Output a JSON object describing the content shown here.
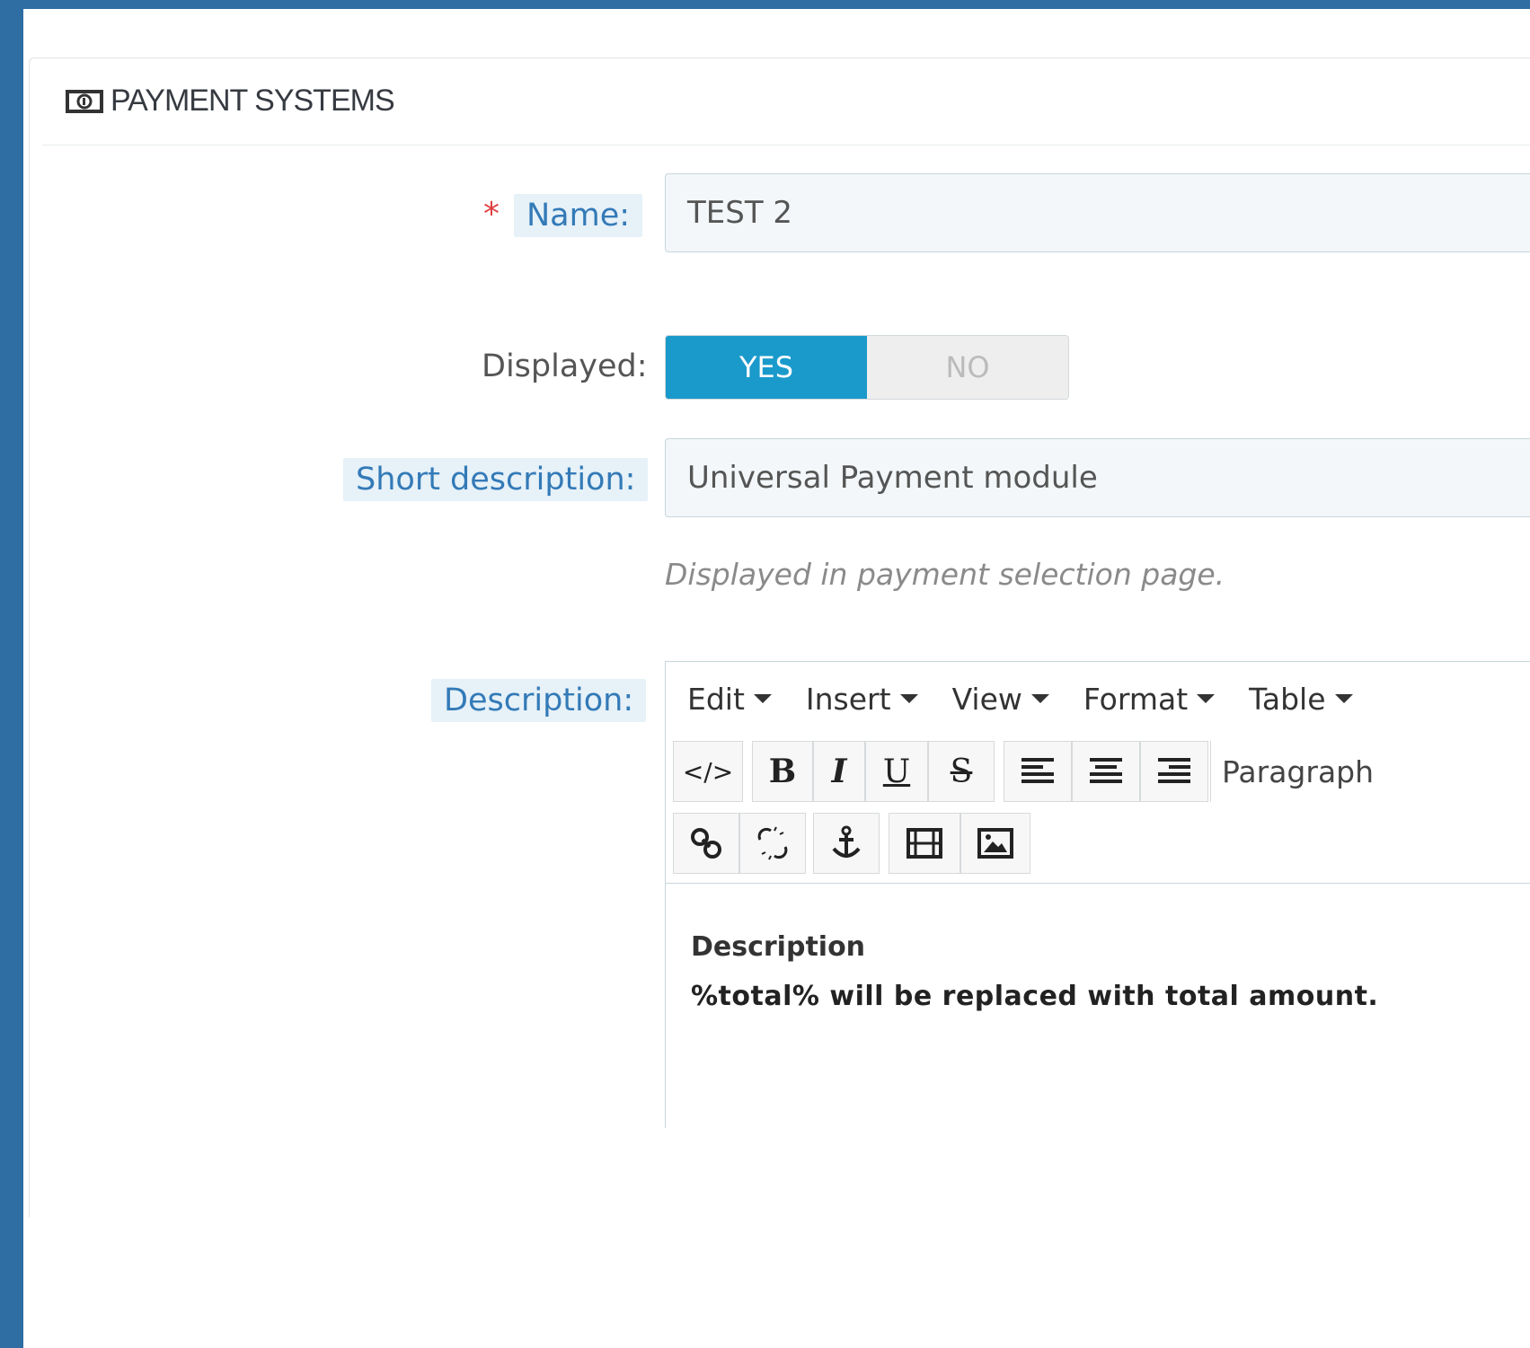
{
  "panel": {
    "title": "PAYMENT SYSTEMS",
    "icon": "money-icon"
  },
  "form": {
    "name": {
      "required_mark": "*",
      "label": "Name:",
      "value": "TEST 2"
    },
    "displayed": {
      "label": "Displayed:",
      "yes_label": "YES",
      "no_label": "NO",
      "selected": "YES"
    },
    "short_description": {
      "label": "Short description:",
      "value": "Universal Payment module",
      "hint": "Displayed in payment selection page."
    },
    "description": {
      "label": "Description:"
    }
  },
  "editor": {
    "menus": [
      "Edit",
      "Insert",
      "View",
      "Format",
      "Table"
    ],
    "toolbar": {
      "source": "source-code-icon",
      "bold": "B",
      "italic": "I",
      "underline": "U",
      "strike": "S",
      "paragraph": "Paragraph"
    },
    "content": {
      "heading": "Description",
      "text": "%total% will be replaced with total amount."
    }
  },
  "colors": {
    "accent": "#1a9acb",
    "sidebar": "#2f6ea3",
    "label_highlight": "#e6f1f8"
  }
}
